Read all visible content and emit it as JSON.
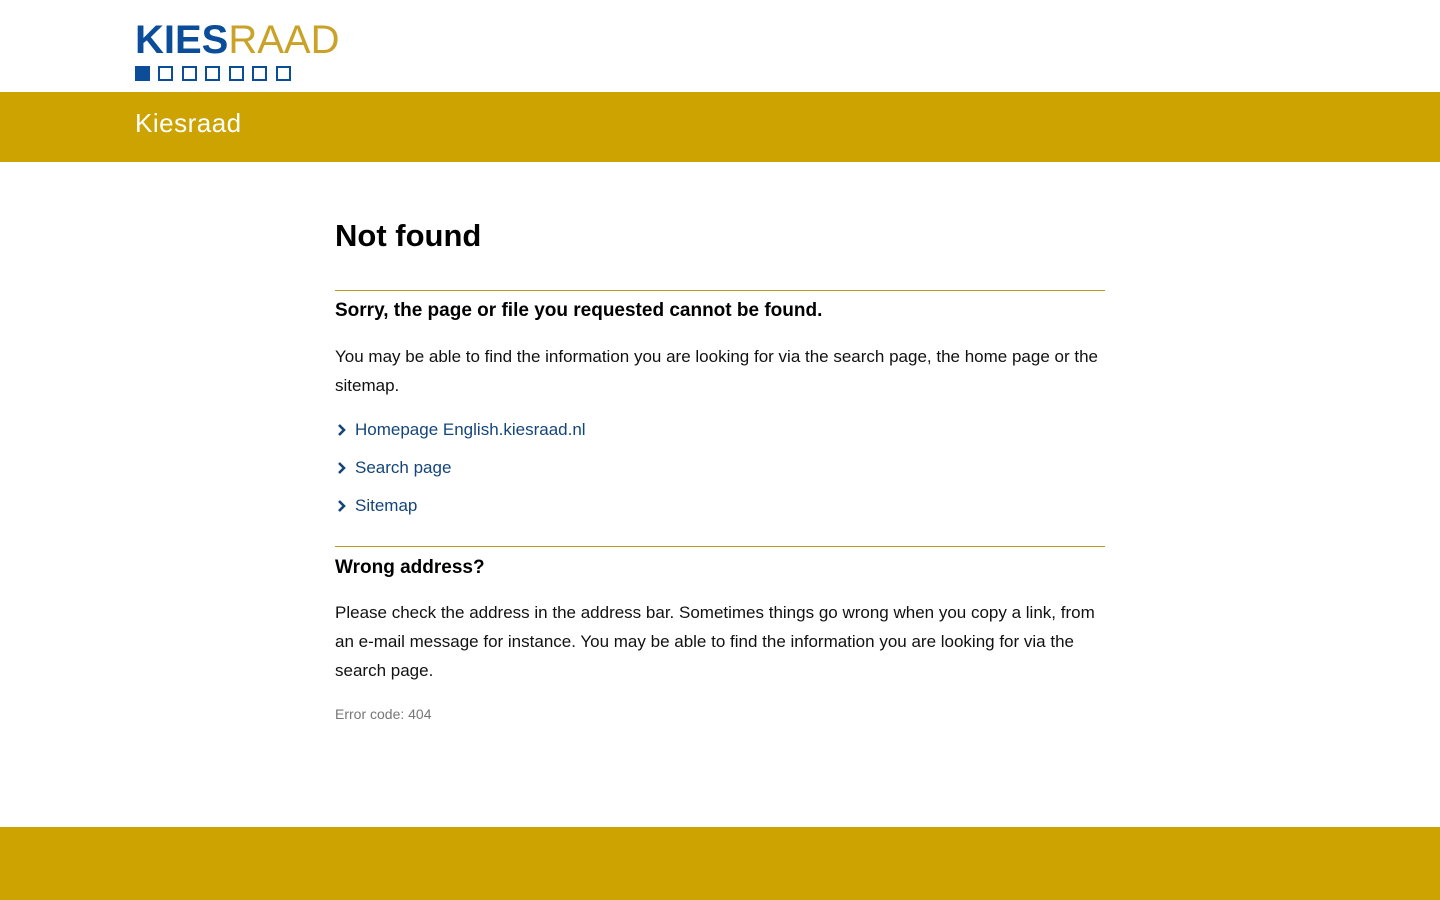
{
  "header": {
    "logo": {
      "part1": "KIES",
      "part2": "RAAD",
      "color_primary": "#0b4d98",
      "color_secondary": "#c9a227"
    }
  },
  "band": {
    "title": "Kiesraad",
    "color": "#cca300"
  },
  "main": {
    "title": "Not found",
    "section1": {
      "heading": "Sorry, the page or file you requested cannot be found.",
      "text": "You may be able to find the information you are looking for via the search page, the home page or the sitemap."
    },
    "links": [
      {
        "label": "Homepage English.kiesraad.nl",
        "icon": "chevron-right-icon"
      },
      {
        "label": "Search page",
        "icon": "chevron-right-icon"
      },
      {
        "label": "Sitemap",
        "icon": "chevron-right-icon"
      }
    ],
    "section2": {
      "heading": "Wrong address?",
      "text": "Please check the address in the address bar. Sometimes things go wrong when you copy a link, from an e-mail message for instance. You may be able to find the information you are looking for via the search page."
    },
    "error_code": "Error code: 404"
  },
  "footer": {
    "color": "#cca300"
  }
}
